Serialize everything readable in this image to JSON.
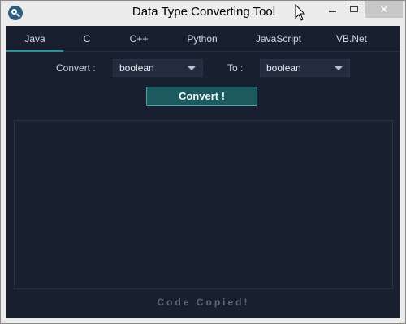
{
  "window": {
    "title": "Data Type Converting Tool",
    "close_glyph": "✕"
  },
  "tabs": [
    {
      "label": "Java",
      "active": true
    },
    {
      "label": "C",
      "active": false
    },
    {
      "label": "C++",
      "active": false
    },
    {
      "label": "Python",
      "active": false
    },
    {
      "label": "JavaScript",
      "active": false
    },
    {
      "label": "VB.Net",
      "active": false
    }
  ],
  "form": {
    "convert_label": "Convert :",
    "from_value": "boolean",
    "to_label": "To :",
    "to_value": "boolean",
    "convert_button_label": "Convert !"
  },
  "output": {
    "text": ""
  },
  "status": {
    "text": "Code Copied!"
  },
  "colors": {
    "background": "#181f2e",
    "accent": "#2f8f9a",
    "button": "#1c5a60",
    "status": "#5e6678"
  },
  "icons": {
    "app": "magnifier-icon",
    "dropdown": "chevron-down-icon",
    "cursor": "mouse-pointer-icon"
  }
}
